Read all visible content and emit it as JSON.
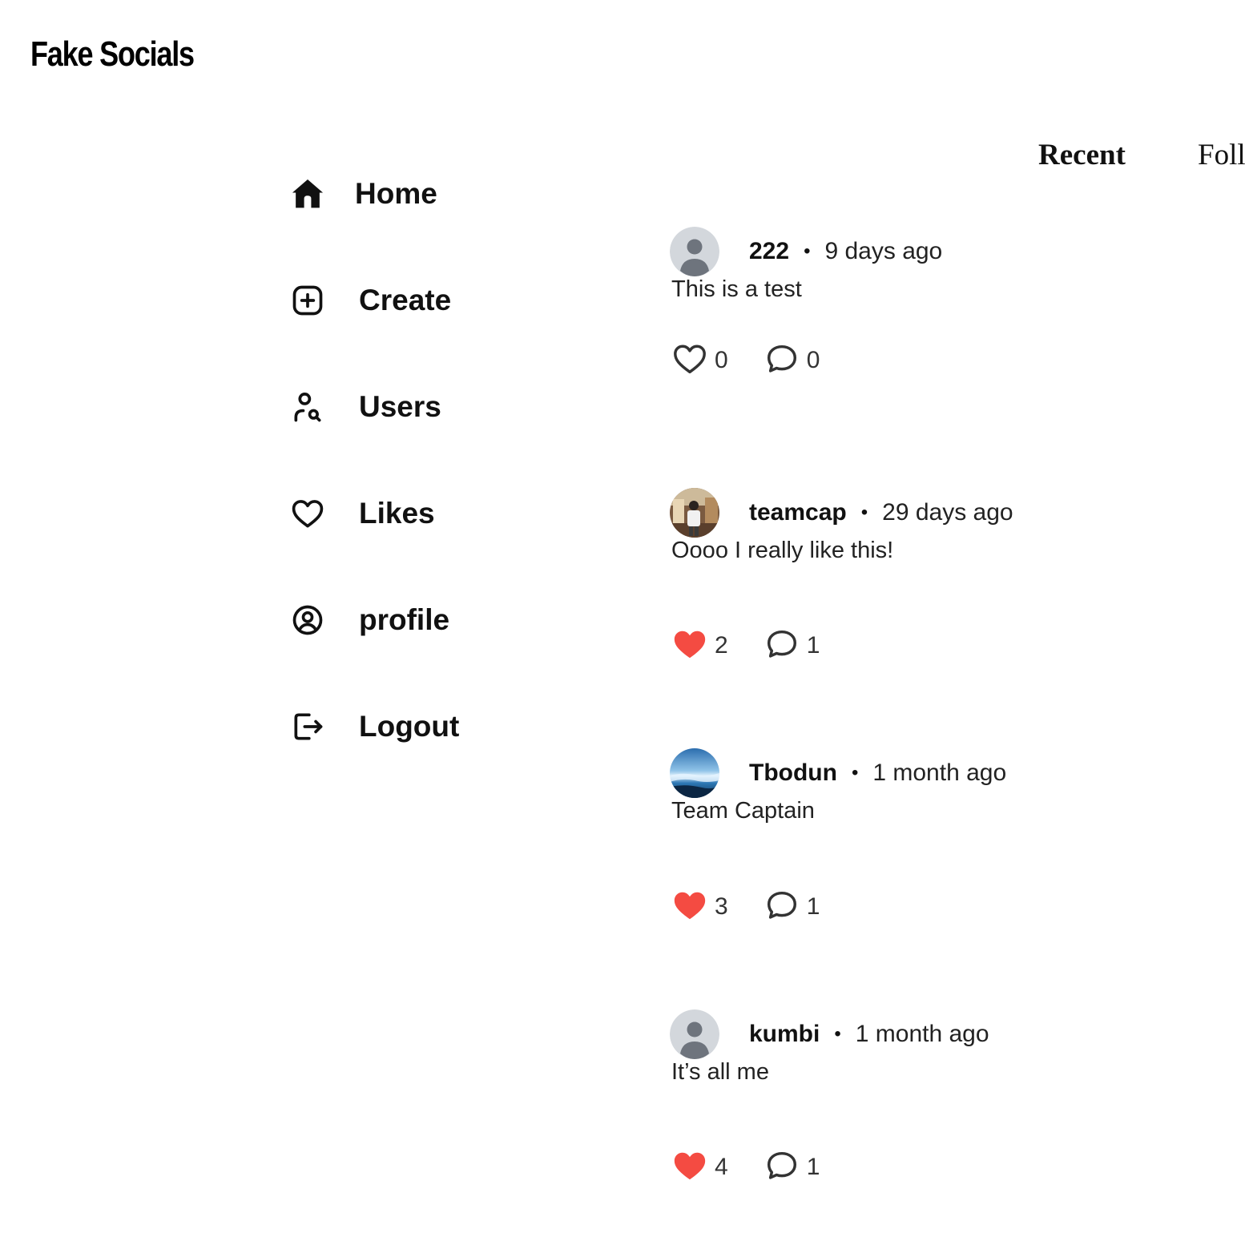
{
  "app": {
    "title": "Fake Socials"
  },
  "nav": [
    {
      "key": "home",
      "label": "Home",
      "icon": "home-icon"
    },
    {
      "key": "create",
      "label": "Create",
      "icon": "plus-square-icon"
    },
    {
      "key": "users",
      "label": "Users",
      "icon": "user-search-icon"
    },
    {
      "key": "likes",
      "label": "Likes",
      "icon": "heart-icon"
    },
    {
      "key": "profile",
      "label": "profile",
      "icon": "user-circle-icon"
    },
    {
      "key": "logout",
      "label": "Logout",
      "icon": "logout-icon"
    }
  ],
  "tabs": {
    "recent": "Recent",
    "following": "Foll"
  },
  "colors": {
    "like_active": "#F44B42",
    "text": "#111111",
    "muted": "#333333"
  },
  "posts": [
    {
      "username": "222",
      "time": "9 days ago",
      "text": "This is a test",
      "likes": "0",
      "comments": "0",
      "liked": false,
      "avatar": "default-avatar"
    },
    {
      "username": "teamcap",
      "time": "29 days ago",
      "text": "Oooo I really like this!",
      "likes": "2",
      "comments": "1",
      "liked": true,
      "avatar": "photo-avatar"
    },
    {
      "username": "Tbodun",
      "time": "1 month ago",
      "text": "Team Captain",
      "likes": "3",
      "comments": "1",
      "liked": true,
      "avatar": "landscape-avatar"
    },
    {
      "username": "kumbi",
      "time": "1 month ago",
      "text": "It’s all me",
      "likes": "4",
      "comments": "1",
      "liked": true,
      "avatar": "default-avatar"
    }
  ]
}
